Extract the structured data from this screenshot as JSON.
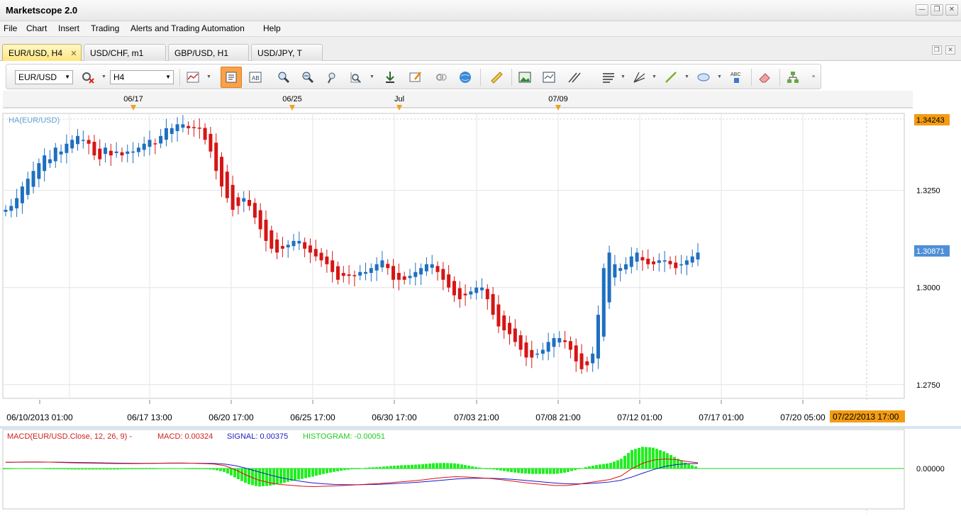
{
  "window": {
    "title": "Marketscope 2.0",
    "min_glyph": "—",
    "restore_glyph": "❐",
    "close_glyph": "✕"
  },
  "menu": [
    "File",
    "Chart",
    "Insert",
    "Trading",
    "Alerts and Trading Automation",
    "Help"
  ],
  "tabs": [
    {
      "label": "EUR/USD, H4",
      "active": true,
      "close": "✕"
    },
    {
      "label": "USD/CHF, m1",
      "active": false
    },
    {
      "label": "GBP/USD, H1",
      "active": false
    },
    {
      "label": "USD/JPY, T",
      "active": false
    }
  ],
  "toolbar": {
    "symbol": "EUR/USD",
    "timeframe": "H4",
    "icons": [
      "chart-type-icon",
      "bar-view-icon",
      "indicator-icon",
      "zoom-in-icon",
      "zoom-out-icon",
      "zoom-region-icon",
      "zoom-select-icon",
      "scroll-end-icon",
      "edit-chart-icon",
      "link-icon",
      "globe-icon",
      "ruler-icon",
      "picture-icon",
      "screenshot-icon",
      "trendline-icon",
      "channel-icon",
      "fibonacci-icon",
      "line-draw-icon",
      "ellipse-icon",
      "text-icon",
      "eraser-icon",
      "tree-icon"
    ]
  },
  "colors": {
    "up": "#1f6fbf",
    "down": "#d61515",
    "macd": "#e01010",
    "signal": "#1818cc",
    "hist": "#22ee22",
    "accent": "#f39c12"
  },
  "chart_data": {
    "type": "candlestick",
    "title": "HA(EUR/USD)",
    "indicator_label": "MACD(EUR/USD.Close, 12, 26, 9) -",
    "macd_label": "MACD: 0.00324",
    "signal_label": "SIGNAL: 0.00375",
    "histogram_label": "HISTOGRAM: -0.00051",
    "price_ticks": [
      "1.3250",
      "1.3000",
      "1.2750"
    ],
    "price_tick_values": [
      1.325,
      1.3,
      1.275
    ],
    "price_markers": {
      "high": "1.34243",
      "current": "1.30871"
    },
    "ylim": [
      1.2715,
      1.3448
    ],
    "macd_tick": "0.00000",
    "x_top_labels": [
      "06/17",
      "06/25",
      "Jul",
      "07/09"
    ],
    "x_bottom_labels": [
      "06/10/2013 01:00",
      "06/17 13:00",
      "06/20 17:00",
      "06/25 17:00",
      "06/30 17:00",
      "07/03 21:00",
      "07/08 21:00",
      "07/12 01:00",
      "07/17 01:00",
      "07/20 05:00"
    ],
    "x_cursor_label": "07/22/2013 17:00",
    "closes": [
      1.32,
      1.321,
      1.323,
      1.326,
      1.328,
      1.33,
      1.332,
      1.334,
      1.333,
      1.336,
      1.335,
      1.337,
      1.338,
      1.339,
      1.338,
      1.337,
      1.334,
      1.333,
      1.336,
      1.334,
      1.335,
      1.334,
      1.335,
      1.335,
      1.336,
      1.337,
      1.338,
      1.337,
      1.339,
      1.341,
      1.341,
      1.342,
      1.342,
      1.341,
      1.341,
      1.341,
      1.338,
      1.335,
      1.33,
      1.326,
      1.323,
      1.32,
      1.321,
      1.323,
      1.321,
      1.318,
      1.315,
      1.312,
      1.31,
      1.309,
      1.31,
      1.311,
      1.312,
      1.312,
      1.31,
      1.309,
      1.308,
      1.307,
      1.306,
      1.304,
      1.302,
      1.303,
      1.303,
      1.303,
      1.304,
      1.304,
      1.305,
      1.306,
      1.307,
      1.305,
      1.302,
      1.302,
      1.302,
      1.303,
      1.304,
      1.305,
      1.306,
      1.306,
      1.304,
      1.302,
      1.3,
      1.298,
      1.297,
      1.298,
      1.299,
      1.3,
      1.3,
      1.297,
      1.293,
      1.29,
      1.289,
      1.288,
      1.286,
      1.284,
      1.282,
      1.282,
      1.283,
      1.284,
      1.286,
      1.287,
      1.287,
      1.286,
      1.284,
      1.281,
      1.279,
      1.28,
      1.283,
      1.293,
      1.305,
      1.309,
      1.306,
      1.305,
      1.306,
      1.308,
      1.309,
      1.307,
      1.306,
      1.306,
      1.307,
      1.307,
      1.306,
      1.305,
      1.306,
      1.307,
      1.308,
      1.309
    ],
    "macd": [
      0.0035,
      0.0036,
      0.0037,
      0.0037,
      0.0036,
      0.0034,
      0.0032,
      0.0031,
      0.003,
      0.0029,
      0.0028,
      0.0028,
      0.0028,
      0.0029,
      0.003,
      0.0031,
      0.0031,
      0.003,
      0.0028,
      0.0025,
      0.0015,
      -0.001,
      -0.004,
      -0.0065,
      -0.008,
      -0.009,
      -0.0095,
      -0.01,
      -0.0102,
      -0.01,
      -0.0098,
      -0.0095,
      -0.0092,
      -0.0088,
      -0.0085,
      -0.008,
      -0.0075,
      -0.007,
      -0.0064,
      -0.0056,
      -0.005,
      -0.0046,
      -0.0048,
      -0.0052,
      -0.0056,
      -0.0062,
      -0.007,
      -0.0078,
      -0.0085,
      -0.009,
      -0.0096,
      -0.0096,
      -0.009,
      -0.008,
      -0.0071,
      -0.0062,
      -0.0042,
      0.0,
      0.003,
      0.0048,
      0.0054,
      0.005,
      0.004,
      0.0032
    ]
  }
}
